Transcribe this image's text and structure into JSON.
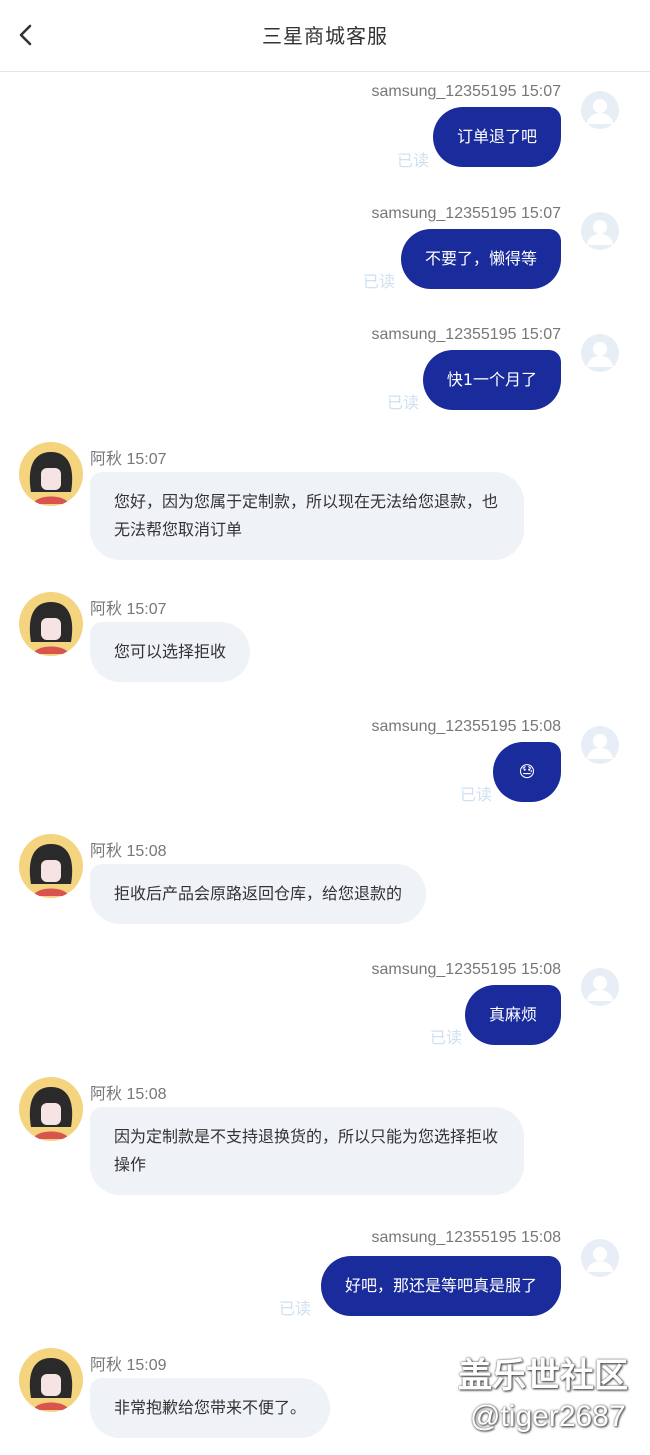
{
  "header": {
    "title": "三星商城客服",
    "back_icon": "chevron-left-icon"
  },
  "messages": [
    {
      "type": "out",
      "sender": "samsung_12355195",
      "time": "15:07",
      "text": "订单退了吧",
      "status": "已读"
    },
    {
      "type": "out",
      "sender": "samsung_12355195",
      "time": "15:07",
      "text": "不要了，懒得等",
      "status": "已读"
    },
    {
      "type": "out",
      "sender": "samsung_12355195",
      "time": "15:07",
      "text": "快1一个月了",
      "status": "已读"
    },
    {
      "type": "in",
      "sender": "阿秋",
      "time": "15:07",
      "text": "您好，因为您属于定制款，所以现在无法给您退款，也无法帮您取消订单"
    },
    {
      "type": "in",
      "sender": "阿秋",
      "time": "15:07",
      "text": "您可以选择拒收"
    },
    {
      "type": "out",
      "sender": "samsung_12355195",
      "time": "15:08",
      "text": "😓",
      "status": "已读"
    },
    {
      "type": "in",
      "sender": "阿秋",
      "time": "15:08",
      "text": "拒收后产品会原路返回仓库，给您退款的"
    },
    {
      "type": "out",
      "sender": "samsung_12355195",
      "time": "15:08",
      "text": "真麻烦",
      "status": "已读"
    },
    {
      "type": "in",
      "sender": "阿秋",
      "time": "15:08",
      "text": "因为定制款是不支持退换货的，所以只能为您选择拒收操作"
    },
    {
      "type": "out",
      "sender": "samsung_12355195",
      "time": "15:08",
      "text": "好吧，那还是等吧真是服了",
      "status": "已读"
    },
    {
      "type": "in",
      "sender": "阿秋",
      "time": "15:09",
      "text": "非常抱歉给您带来不便了。"
    }
  ],
  "watermark": {
    "line1": "盖乐世社区",
    "line2": "@tiger2687"
  },
  "colors": {
    "out_bubble": "#1a2b9b",
    "in_bubble": "#eff2f6",
    "read_status": "#cfe0f0"
  }
}
